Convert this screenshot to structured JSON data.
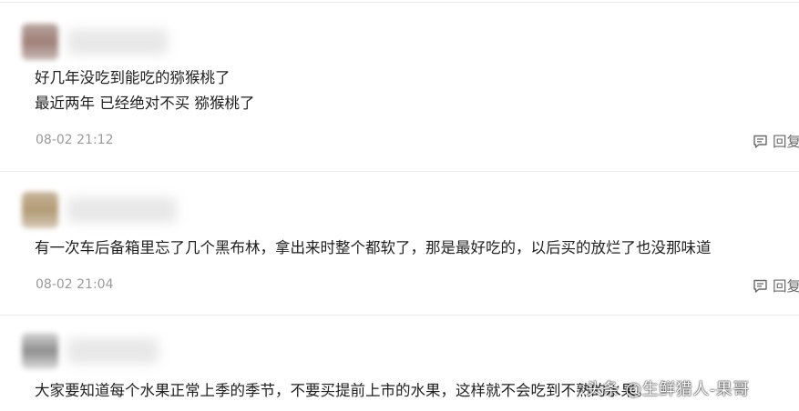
{
  "comments": [
    {
      "lines": [
        "好几年没吃到能吃的猕猴桃了",
        "最近两年 已经绝对不买 猕猴桃了"
      ],
      "time": "08-02 21:12",
      "reply_label": "回复"
    },
    {
      "lines": [
        "有一次车后备箱里忘了几个黑布林，拿出来时整个都软了，那是最好吃的，以后买的放烂了也没那味道"
      ],
      "time": "08-02 21:04",
      "reply_label": "回复"
    },
    {
      "lines": [
        "大家要知道每个水果正常上季的季节，不要买提前上市的水果，这样就不会吃到不熟的水果。"
      ]
    }
  ],
  "watermark": "头条 @生鲜猎人-果哥",
  "icons": {
    "reply": "reply-comment-icon"
  },
  "colors": {
    "text": "#1f1f1f",
    "meta": "#9a9a9a",
    "divider": "#e9e9e9"
  }
}
